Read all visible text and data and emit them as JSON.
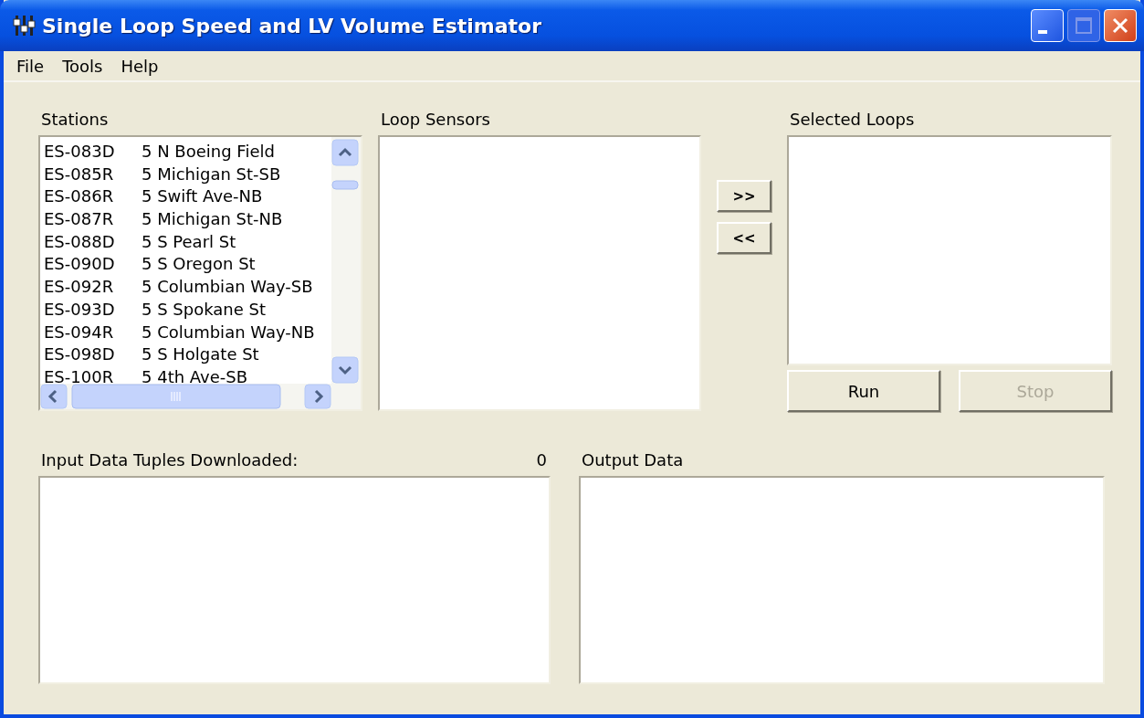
{
  "window": {
    "title": "Single Loop Speed and LV Volume Estimator"
  },
  "menu": [
    {
      "label": "File"
    },
    {
      "label": "Tools"
    },
    {
      "label": "Help"
    }
  ],
  "stations": {
    "label": "Stations",
    "rows": [
      {
        "code": "ES-083D",
        "name": "5 N Boeing Field"
      },
      {
        "code": "ES-085R",
        "name": "5 Michigan St-SB"
      },
      {
        "code": "ES-086R",
        "name": "5 Swift Ave-NB"
      },
      {
        "code": "ES-087R",
        "name": "5 Michigan St-NB"
      },
      {
        "code": "ES-088D",
        "name": "5 S Pearl St"
      },
      {
        "code": "ES-090D",
        "name": "5 S Oregon St"
      },
      {
        "code": "ES-092R",
        "name": "5 Columbian Way-SB"
      },
      {
        "code": "ES-093D",
        "name": "5 S Spokane St"
      },
      {
        "code": "ES-094R",
        "name": "5 Columbian Way-NB"
      },
      {
        "code": "ES-098D",
        "name": "5 S Holgate St"
      },
      {
        "code": "ES-100R",
        "name": "5 4th Ave-SB"
      }
    ]
  },
  "loop_sensors": {
    "label": "Loop Sensors"
  },
  "transfer_buttons": [
    {
      "label": ">>"
    },
    {
      "label": "<<"
    }
  ],
  "selected_loops": {
    "label": "Selected Loops"
  },
  "actions": [
    {
      "label": "Run",
      "disabled": false
    },
    {
      "label": "Stop",
      "disabled": true
    }
  ],
  "input_data": {
    "label": "Input Data Tuples Downloaded:",
    "count": "0"
  },
  "output_data": {
    "label": "Output Data"
  }
}
